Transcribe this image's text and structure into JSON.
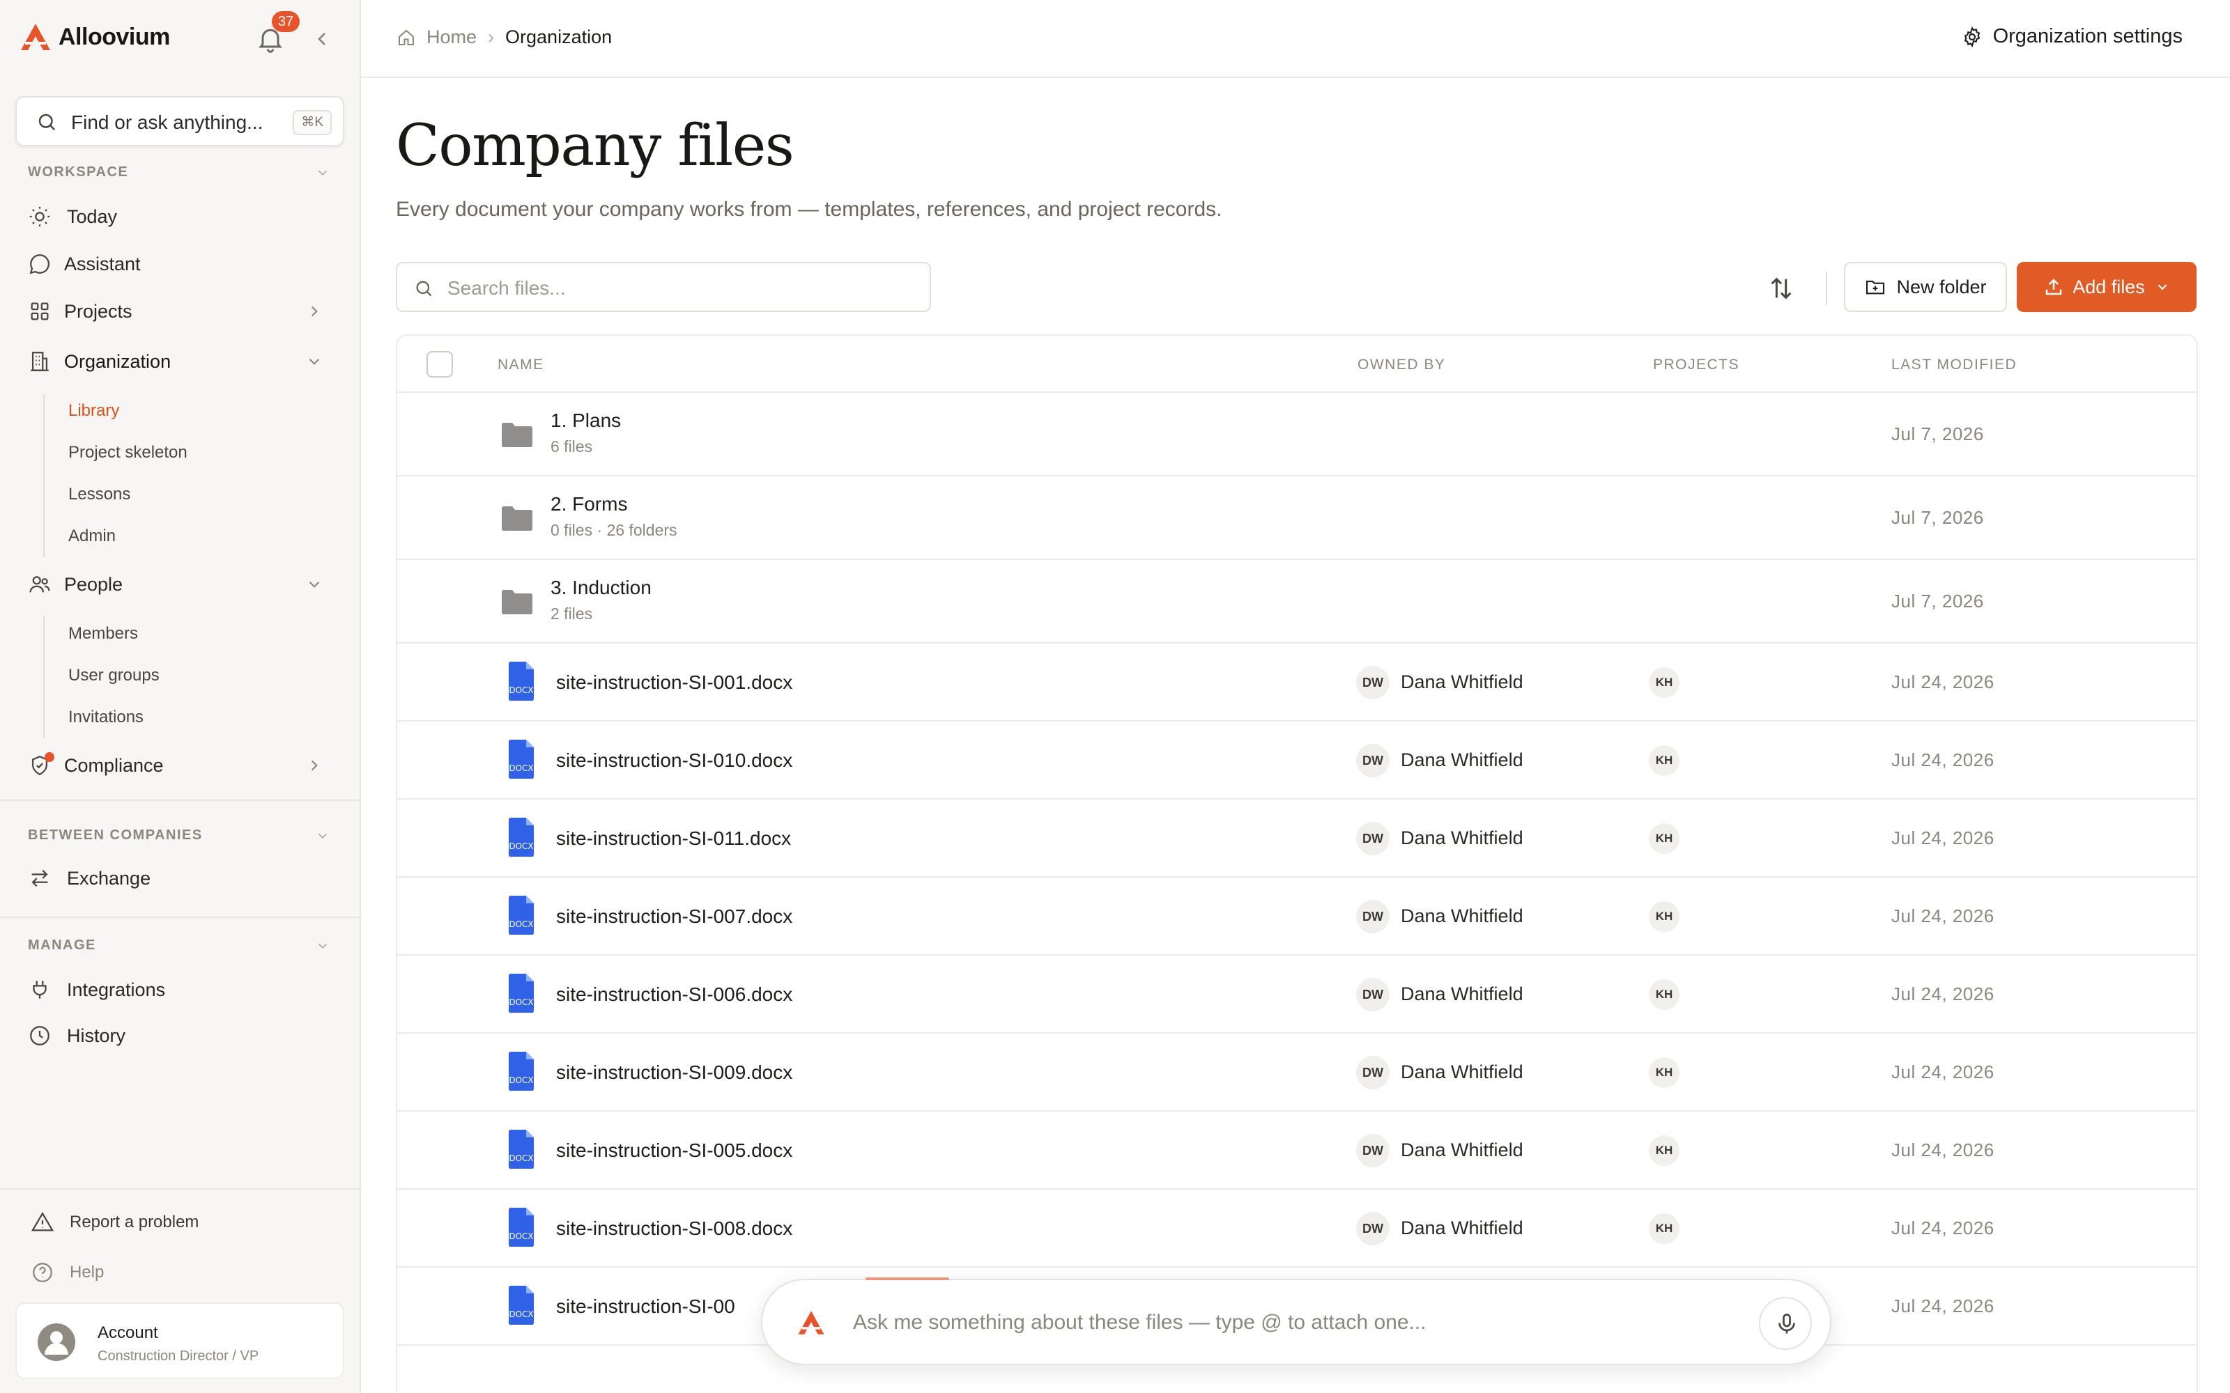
{
  "app": {
    "name": "Alloovium",
    "notification_count": "37",
    "brand_color": "#e15c25"
  },
  "search": {
    "placeholder": "Find or ask anything...",
    "shortcut": "⌘K"
  },
  "sidebar": {
    "workspace_label": "WORKSPACE",
    "workspace_items": [
      {
        "label": "Today",
        "icon": "sun-icon"
      },
      {
        "label": "Assistant",
        "icon": "chat-bubble-icon"
      },
      {
        "label": "Projects",
        "icon": "grid-icon"
      },
      {
        "label": "Organization",
        "icon": "building-icon"
      }
    ],
    "organization_sub": [
      "Library",
      "Project skeleton",
      "Lessons",
      "Admin"
    ],
    "people_label": "People",
    "people_sub": [
      "Members",
      "User groups",
      "Invitations"
    ],
    "compliance_label": "Compliance",
    "between_label": "BETWEEN COMPANIES",
    "exchange_label": "Exchange",
    "manage_label": "MANAGE",
    "integrations_label": "Integrations",
    "history_label": "History",
    "report_label": "Report a problem",
    "help_label": "Help",
    "account": {
      "name": "Account",
      "role": "Construction Director / VP"
    }
  },
  "breadcrumb": {
    "home": "Home",
    "current": "Organization"
  },
  "header": {
    "org_settings": "Organization settings"
  },
  "page": {
    "title": "Company files",
    "subtitle": "Every document your company works from — templates, references, and project records."
  },
  "toolbar": {
    "search_placeholder": "Search files...",
    "new_folder": "New folder",
    "add_files": "Add files"
  },
  "table": {
    "columns": {
      "name": "NAME",
      "owner": "OWNED BY",
      "projects": "PROJECTS",
      "modified": "LAST MODIFIED"
    },
    "folders": [
      {
        "name": "1. Plans",
        "meta": "6 files",
        "modified": "Jul 7, 2026"
      },
      {
        "name": "2. Forms",
        "meta": "0 files · 26 folders",
        "modified": "Jul 7, 2026"
      },
      {
        "name": "3. Induction",
        "meta": "2 files",
        "modified": "Jul 7, 2026"
      }
    ],
    "files": [
      {
        "name": "site-instruction-SI-001.docx",
        "owner_initials": "DW",
        "owner": "Dana Whitfield",
        "project": "KH",
        "modified": "Jul 24, 2026"
      },
      {
        "name": "site-instruction-SI-010.docx",
        "owner_initials": "DW",
        "owner": "Dana Whitfield",
        "project": "KH",
        "modified": "Jul 24, 2026"
      },
      {
        "name": "site-instruction-SI-011.docx",
        "owner_initials": "DW",
        "owner": "Dana Whitfield",
        "project": "KH",
        "modified": "Jul 24, 2026"
      },
      {
        "name": "site-instruction-SI-007.docx",
        "owner_initials": "DW",
        "owner": "Dana Whitfield",
        "project": "KH",
        "modified": "Jul 24, 2026"
      },
      {
        "name": "site-instruction-SI-006.docx",
        "owner_initials": "DW",
        "owner": "Dana Whitfield",
        "project": "KH",
        "modified": "Jul 24, 2026"
      },
      {
        "name": "site-instruction-SI-009.docx",
        "owner_initials": "DW",
        "owner": "Dana Whitfield",
        "project": "KH",
        "modified": "Jul 24, 2026"
      },
      {
        "name": "site-instruction-SI-005.docx",
        "owner_initials": "DW",
        "owner": "Dana Whitfield",
        "project": "KH",
        "modified": "Jul 24, 2026"
      },
      {
        "name": "site-instruction-SI-008.docx",
        "owner_initials": "DW",
        "owner": "Dana Whitfield",
        "project": "KH",
        "modified": "Jul 24, 2026"
      },
      {
        "name": "site-instruction-SI-00",
        "owner_initials": "",
        "owner": "",
        "project": "",
        "modified": "Jul 24, 2026"
      }
    ],
    "doc_icon_label": "DOCX"
  },
  "ask": {
    "placeholder": "Ask me something about these files — type @ to attach one..."
  }
}
